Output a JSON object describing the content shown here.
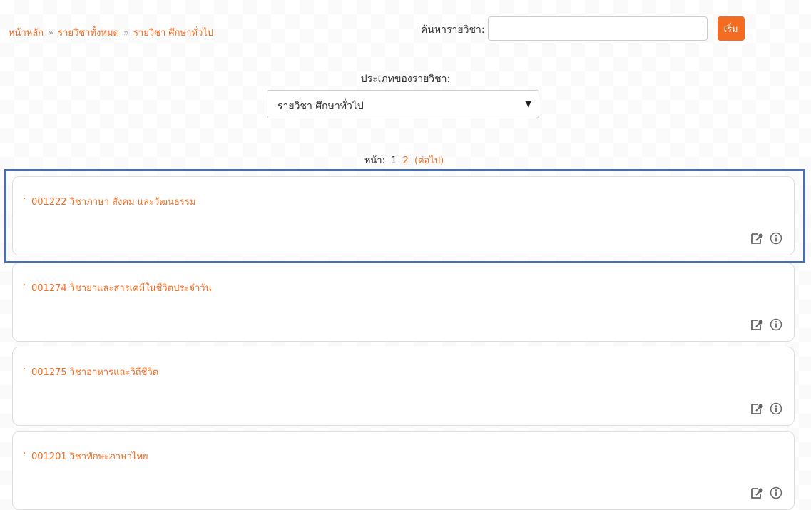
{
  "breadcrumb": {
    "items": [
      "หน้าหลัก",
      "รายวิชาทั้งหมด",
      "รายวิชา ศึกษาทั่วไป"
    ],
    "separator": "»"
  },
  "search": {
    "label": "ค้นหารายวิชา:",
    "value": "",
    "placeholder": "",
    "button_label": "เริ่ม"
  },
  "category": {
    "label": "ประเภทของรายวิชา:",
    "selected": "รายวิชา ศึกษาทั่วไป"
  },
  "paging": {
    "label": "หน้า:",
    "current": "1",
    "next_page": "2",
    "next_label": "(ต่อไป)"
  },
  "courses": [
    {
      "title": "001222 วิชาภาษา สังคม และวัฒนธรรม"
    },
    {
      "title": "001274 วิชายาและสารเคมีในชีวิตประจำวัน"
    },
    {
      "title": "001275 วิชาอาหารและวิถีชีวิต"
    },
    {
      "title": "001201 วิชาทักษะภาษาไทย"
    }
  ],
  "colors": {
    "accent": "#f26c21",
    "highlight_border": "#4a6fb5"
  },
  "icons": {
    "edit": "edit-key-icon",
    "info": "info-icon"
  }
}
